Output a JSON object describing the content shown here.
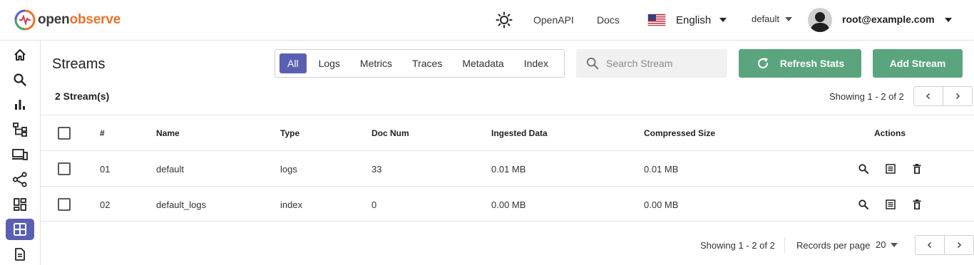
{
  "header": {
    "logo_prefix": "open",
    "logo_suffix": "observe",
    "openapi_label": "OpenAPI",
    "docs_label": "Docs",
    "language": "English",
    "org": "default",
    "user_email": "root@example.com"
  },
  "sidebar": {
    "items": [
      {
        "icon": "home-icon"
      },
      {
        "icon": "search-icon"
      },
      {
        "icon": "bar-chart-icon"
      },
      {
        "icon": "hierarchy-icon"
      },
      {
        "icon": "devices-icon"
      },
      {
        "icon": "share-icon"
      },
      {
        "icon": "dashboard-icon"
      },
      {
        "icon": "grid-icon",
        "active": true
      },
      {
        "icon": "document-icon"
      }
    ],
    "accent": "#5960b2"
  },
  "main": {
    "title": "Streams",
    "tabs": [
      "All",
      "Logs",
      "Metrics",
      "Traces",
      "Metadata",
      "Index"
    ],
    "active_tab": "All",
    "search_placeholder": "Search Stream",
    "refresh_label": "Refresh Stats",
    "add_label": "Add Stream",
    "stream_count": "2 Stream(s)",
    "showing_top": "Showing 1 - 2 of 2",
    "showing_bottom": "Showing 1 - 2 of 2",
    "records_per_page_label": "Records per page",
    "records_per_page": "20",
    "button_color": "#5ba57e"
  },
  "table": {
    "columns": [
      "#",
      "Name",
      "Type",
      "Doc Num",
      "Ingested Data",
      "Compressed Size",
      "Actions"
    ],
    "rows": [
      {
        "num": "01",
        "name": "default",
        "type": "logs",
        "doc_num": "33",
        "ingested": "0.01 MB",
        "compressed": "0.01 MB"
      },
      {
        "num": "02",
        "name": "default_logs",
        "type": "index",
        "doc_num": "0",
        "ingested": "0.00 MB",
        "compressed": "0.00 MB"
      }
    ]
  }
}
